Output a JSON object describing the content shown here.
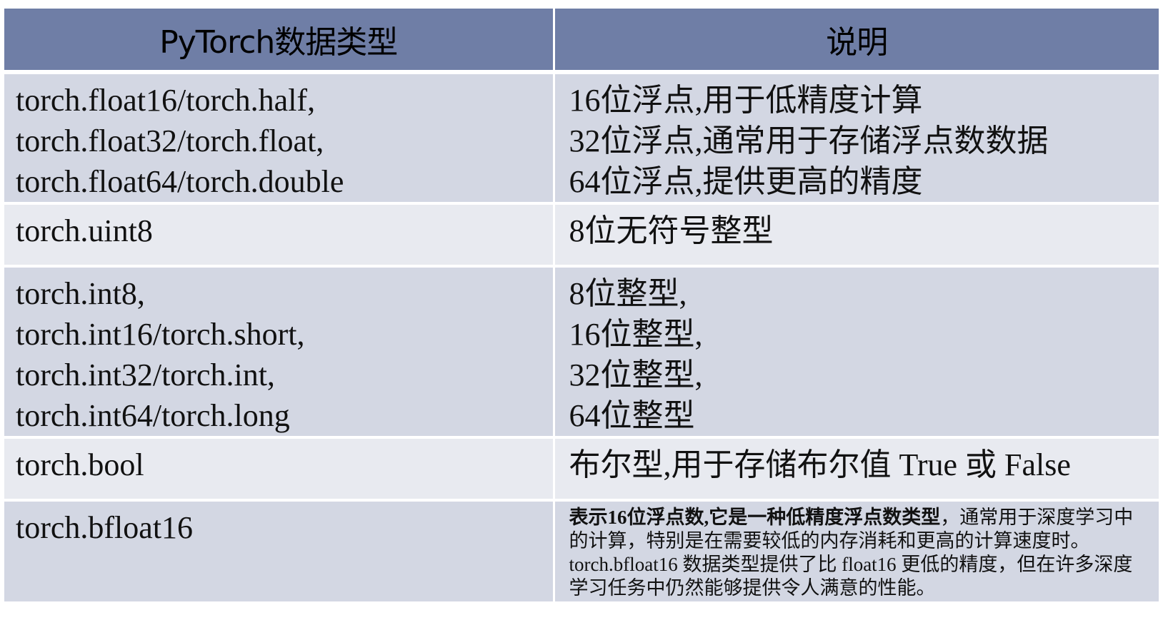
{
  "table": {
    "headers": [
      "PyTorch数据类型",
      "说明"
    ],
    "rows": [
      {
        "type_lines": [
          "torch.float16/torch.half,",
          "torch.float32/torch.float,",
          "torch.float64/torch.double"
        ],
        "desc_lines": [
          "16位浮点,用于低精度计算",
          "32位浮点,通常用于存储浮点数数据",
          "64位浮点,提供更高的精度"
        ]
      },
      {
        "type_lines": [
          "torch.uint8"
        ],
        "desc_lines": [
          "8位无符号整型"
        ]
      },
      {
        "type_lines": [
          "torch.int8,",
          "torch.int16/torch.short,",
          "torch.int32/torch.int,",
          "torch.int64/torch.long"
        ],
        "desc_lines": [
          "8位整型,",
          "16位整型,",
          "32位整型,",
          "64位整型"
        ]
      },
      {
        "type_lines": [
          "torch.bool"
        ],
        "desc_lines": [
          "布尔型,用于存储布尔值 True 或 False"
        ]
      },
      {
        "type_lines": [
          "torch.bfloat16"
        ],
        "desc_bold": "表示16位浮点数,它是一种低精度浮点数类型",
        "desc_rest": "，通常用于深度学习中的计算，特别是在需要较低的内存消耗和更高的计算速度时。torch.bfloat16 数据类型提供了比 float16 更低的精度，但在许多深度学习任务中仍然能够提供令人满意的性能。"
      }
    ]
  }
}
